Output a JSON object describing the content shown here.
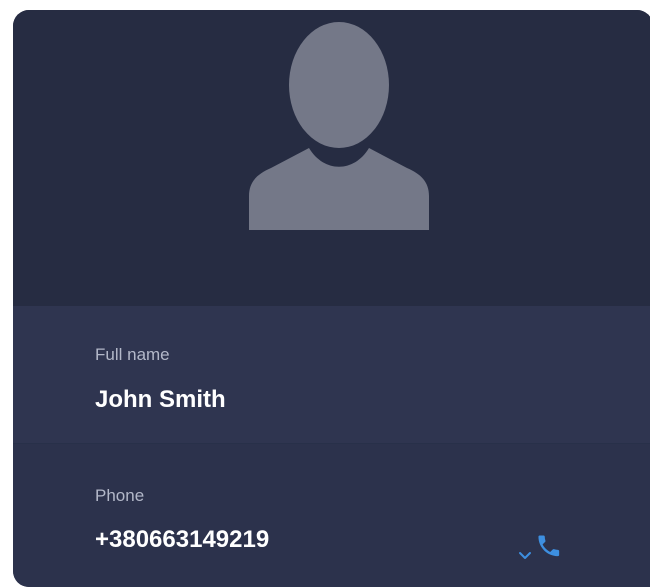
{
  "contact": {
    "full_name_label": "Full name",
    "full_name_value": "John Smith",
    "phone_label": "Phone",
    "phone_value": "+380663149219"
  },
  "icons": {
    "avatar": "user-silhouette-icon",
    "call": "phone-call-icon",
    "chevron": "chevron-down-icon"
  },
  "colors": {
    "card_bg": "#282e45",
    "field_bg": "#2f3550",
    "avatar_fill": "#747888",
    "accent": "#3d8fe0"
  }
}
